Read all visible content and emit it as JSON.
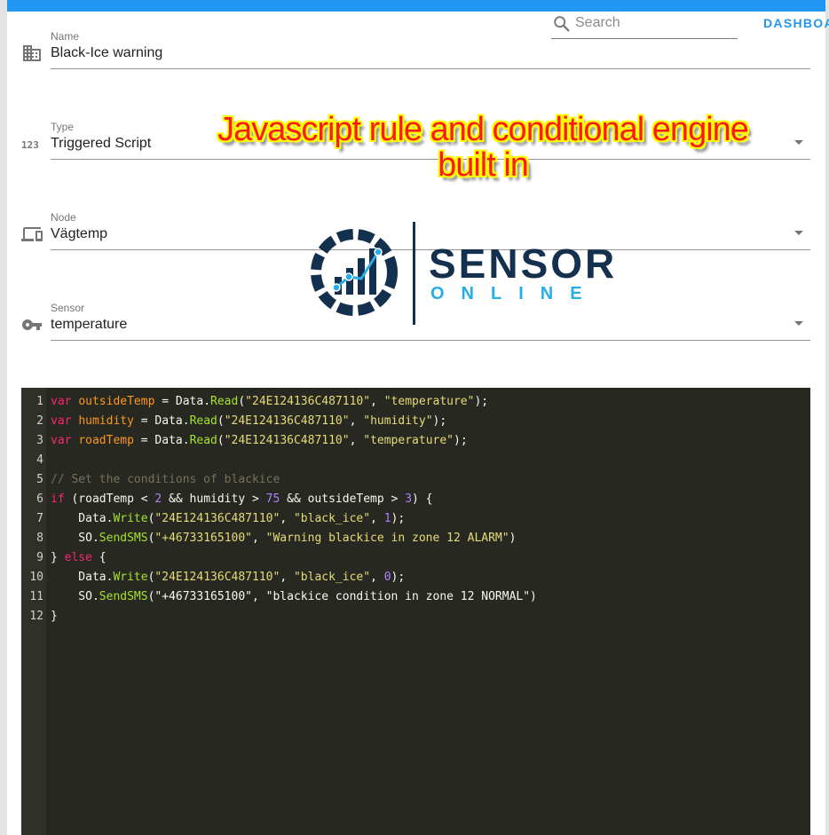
{
  "search": {
    "placeholder": "Search"
  },
  "nav": {
    "dashboard_label": "DASHBOA"
  },
  "form": {
    "name": {
      "label": "Name",
      "value": "Black-Ice warning",
      "icon": "building-icon"
    },
    "type": {
      "label": "Type",
      "value": "Triggered Script",
      "icon": "numeric-icon"
    },
    "node": {
      "label": "Node",
      "value": "Vägtemp",
      "icon": "devices-icon"
    },
    "sensor": {
      "label": "Sensor",
      "value": "temperature",
      "icon": "key-icon"
    }
  },
  "annotation": {
    "line1": "Javascript rule and conditional engine",
    "line2": "built in",
    "color": "#ff1a1a",
    "outline_color": "#ffff00"
  },
  "logo": {
    "word1": "SENSOR",
    "word2": "ONLINE",
    "navy": "#14304f",
    "cyan": "#27aee6"
  },
  "editor": {
    "background": "#272822",
    "lines": [
      [
        [
          "kw",
          "var"
        ],
        [
          "t",
          " "
        ],
        [
          "var",
          "outsideTemp"
        ],
        [
          "t",
          " = Data."
        ],
        [
          "fn",
          "Read"
        ],
        [
          "t",
          "("
        ],
        [
          "str",
          "\"24E124136C487110\""
        ],
        [
          "t",
          ", "
        ],
        [
          "str",
          "\"temperature\""
        ],
        [
          "t",
          ");"
        ]
      ],
      [
        [
          "kw",
          "var"
        ],
        [
          "t",
          " "
        ],
        [
          "var",
          "humidity"
        ],
        [
          "t",
          " = Data."
        ],
        [
          "fn",
          "Read"
        ],
        [
          "t",
          "("
        ],
        [
          "str",
          "\"24E124136C487110\""
        ],
        [
          "t",
          ", "
        ],
        [
          "str",
          "\"humidity\""
        ],
        [
          "t",
          ");"
        ]
      ],
      [
        [
          "kw",
          "var"
        ],
        [
          "t",
          " "
        ],
        [
          "var",
          "roadTemp"
        ],
        [
          "t",
          " = Data."
        ],
        [
          "fn",
          "Read"
        ],
        [
          "t",
          "("
        ],
        [
          "str",
          "\"24E124136C487110\""
        ],
        [
          "t",
          ", "
        ],
        [
          "str",
          "\"temperature\""
        ],
        [
          "t",
          ");"
        ]
      ],
      [],
      [
        [
          "cm",
          "// Set the conditions of blackice"
        ]
      ],
      [
        [
          "kw",
          "if"
        ],
        [
          "t",
          " (roadTemp < "
        ],
        [
          "num",
          "2"
        ],
        [
          "t",
          " && humidity > "
        ],
        [
          "num",
          "75"
        ],
        [
          "t",
          " && outsideTemp > "
        ],
        [
          "num",
          "3"
        ],
        [
          "t",
          ") {"
        ]
      ],
      [
        [
          "t",
          "    Data."
        ],
        [
          "fn",
          "Write"
        ],
        [
          "t",
          "("
        ],
        [
          "str",
          "\"24E124136C487110\""
        ],
        [
          "t",
          ", "
        ],
        [
          "str",
          "\"black_ice\""
        ],
        [
          "t",
          ", "
        ],
        [
          "num",
          "1"
        ],
        [
          "t",
          ");"
        ]
      ],
      [
        [
          "t",
          "    SO."
        ],
        [
          "fn",
          "SendSMS"
        ],
        [
          "t",
          "("
        ],
        [
          "str",
          "\"+46733165100\""
        ],
        [
          "t",
          ", "
        ],
        [
          "str",
          "\"Warning blackice in zone 12 ALARM\""
        ],
        [
          "t",
          ")"
        ]
      ],
      [
        [
          "t",
          "} "
        ],
        [
          "kw",
          "else"
        ],
        [
          "t",
          " {"
        ]
      ],
      [
        [
          "t",
          "    Data."
        ],
        [
          "fn",
          "Write"
        ],
        [
          "t",
          "("
        ],
        [
          "str",
          "\"24E124136C487110\""
        ],
        [
          "t",
          ", "
        ],
        [
          "str",
          "\"black_ice\""
        ],
        [
          "t",
          ", "
        ],
        [
          "num",
          "0"
        ],
        [
          "t",
          ");"
        ]
      ],
      [
        [
          "t",
          "    SO."
        ],
        [
          "fn",
          "SendSMS"
        ],
        [
          "t",
          "(\"+46733165100\", \"blackice condition in zone 12 NORMAL\")"
        ]
      ],
      [
        [
          "t",
          "}"
        ]
      ]
    ]
  }
}
